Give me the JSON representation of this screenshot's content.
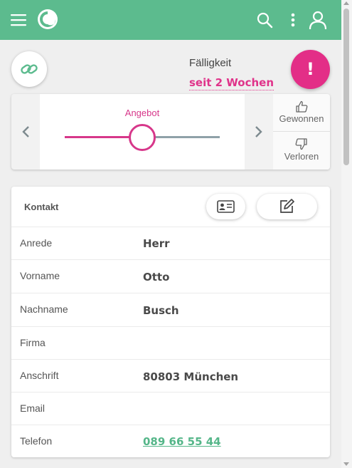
{
  "due": {
    "label": "Fälligkeit",
    "value": "seit 2 Wochen"
  },
  "alert": {
    "label": "!"
  },
  "stage": {
    "label": "Angebot",
    "won_label": "Gewonnen",
    "lost_label": "Verloren",
    "progress": 0.5
  },
  "contact": {
    "title": "Kontakt",
    "rows": [
      {
        "label": "Anrede",
        "value": "Herr"
      },
      {
        "label": "Vorname",
        "value": "Otto"
      },
      {
        "label": "Nachname",
        "value": "Busch"
      },
      {
        "label": "Firma",
        "value": ""
      },
      {
        "label": "Anschrift",
        "value": "80803 München"
      },
      {
        "label": "Email",
        "value": ""
      },
      {
        "label": "Telefon",
        "value": "089 66 55 44"
      }
    ]
  },
  "icons": {
    "menu": "hamburger-menu-icon",
    "logo": "swirl-logo",
    "search": "search-icon",
    "more": "more-vertical-icon",
    "user": "user-icon",
    "link": "link-icon",
    "thumbs_up": "thumbs-up-icon",
    "thumbs_down": "thumbs-down-icon",
    "vcard": "contact-card-icon",
    "edit": "edit-icon"
  },
  "colors": {
    "appbar": "#5cbb8e",
    "accent_pink": "#e32e87",
    "link_green": "#55b689",
    "track_grey": "#8fa1a8"
  }
}
